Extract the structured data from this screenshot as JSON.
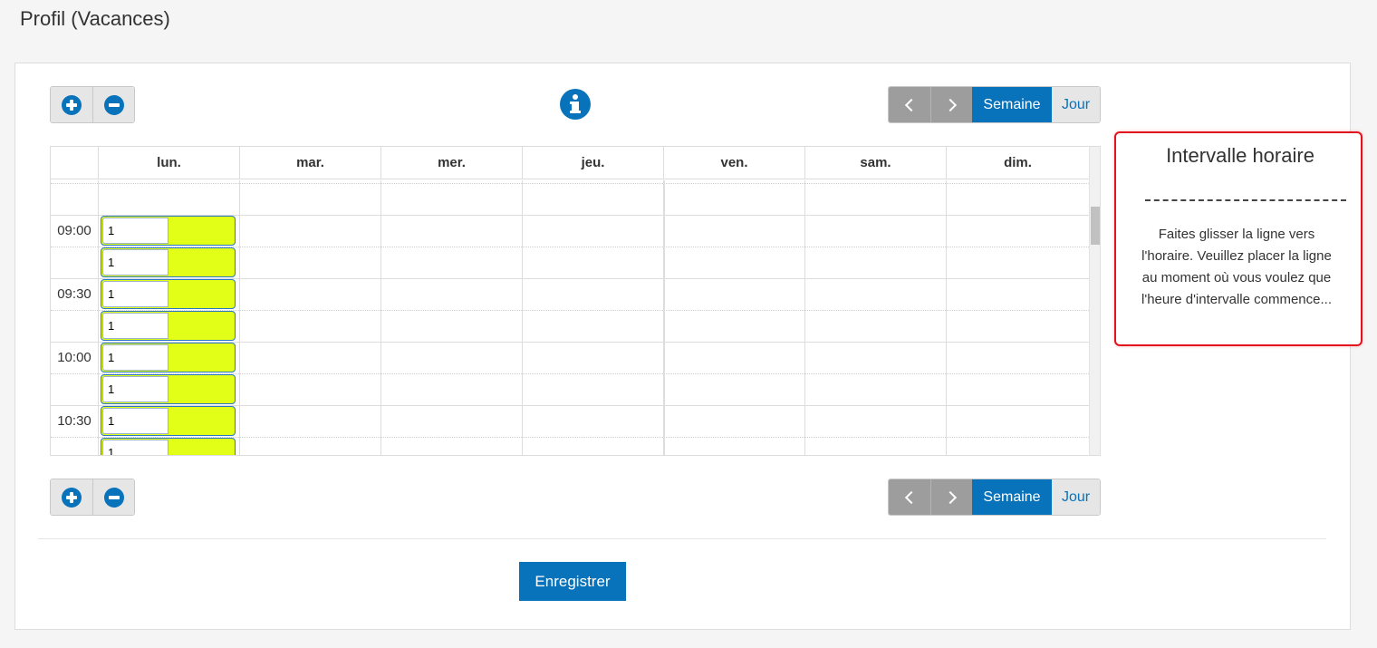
{
  "page": {
    "title": "Profil (Vacances)"
  },
  "toolbar": {
    "zoom_in_icon": "plus-circle-icon",
    "zoom_out_icon": "minus-circle-icon",
    "info_icon": "info-circle-icon",
    "prev_icon": "chevron-left-icon",
    "next_icon": "chevron-right-icon",
    "view_week": "Semaine",
    "view_day": "Jour",
    "active_view": "Semaine"
  },
  "calendar": {
    "days": [
      "lun.",
      "mar.",
      "mer.",
      "jeu.",
      "ven.",
      "sam.",
      "dim."
    ],
    "times": [
      "09:00",
      "09:30",
      "10:00",
      "10:30"
    ],
    "events": [
      {
        "day": "lun.",
        "value": "1"
      },
      {
        "day": "lun.",
        "value": "1"
      },
      {
        "day": "lun.",
        "value": "1"
      },
      {
        "day": "lun.",
        "value": "1"
      },
      {
        "day": "lun.",
        "value": "1"
      },
      {
        "day": "lun.",
        "value": "1"
      },
      {
        "day": "lun.",
        "value": "1"
      },
      {
        "day": "lun.",
        "value": "1"
      }
    ],
    "event_color": "#e1ff17"
  },
  "tooltip": {
    "title": "Intervalle horaire",
    "separator": "------------------------",
    "body": "Faites glisser la ligne vers l'horaire. Veuillez placer la ligne au moment où vous voulez que l'heure d'intervalle commence..."
  },
  "actions": {
    "save_label": "Enregistrer"
  },
  "colors": {
    "accent": "#0873bb",
    "highlight_border": "#e3131e"
  }
}
